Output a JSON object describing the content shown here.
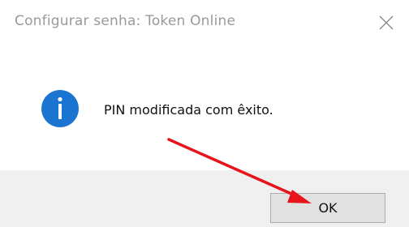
{
  "window": {
    "title": "Configurar senha: Token Online",
    "close_icon": "close-icon"
  },
  "message": {
    "icon": "info-icon",
    "text": "PIN modificada com êxito."
  },
  "footer": {
    "ok_label": "OK"
  },
  "colors": {
    "info_blue": "#1a74d0",
    "arrow_red": "#e8141b",
    "footer_bg": "#f0f0f0",
    "button_bg": "#e1e1e1"
  }
}
